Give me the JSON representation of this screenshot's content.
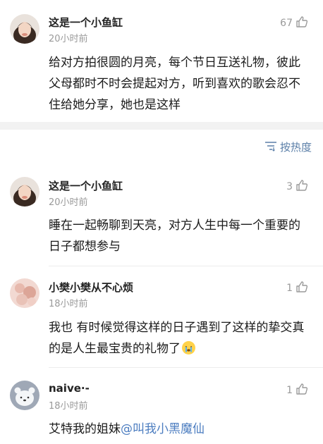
{
  "comments": [
    {
      "username": "这是一个小鱼缸",
      "time": "20小时前",
      "likes": "67",
      "body": "给对方拍很圆的月亮，每个节日互送礼物，彼此父母都时不时会提起对方，听到喜欢的歌会忍不住给她分享，她也是这样"
    },
    {
      "username": "这是一个小鱼缸",
      "time": "20小时前",
      "likes": "3",
      "body": "睡在一起畅聊到天亮，对方人生中每一个重要的日子都想参与"
    },
    {
      "username": "小樊小樊从不心烦",
      "time": "18小时前",
      "likes": "1",
      "body": "我也  有时候觉得这样的日子遇到了这样的挚交真的是人生最宝贵的礼物了"
    },
    {
      "username": "naive·-",
      "time": "18小时前",
      "likes": "1",
      "body_prefix": "艾特我的姐妹",
      "mention": "@叫我小黑魔仙"
    }
  ],
  "sort": {
    "label": "按热度",
    "icon": "sort-icon"
  },
  "icons": {
    "like": "thumbs-up-icon",
    "emoji": "crying-face-emoji"
  },
  "colors": {
    "link": "#4c7dc0",
    "muted": "#9a9a9a",
    "separator": "#f2f2f2"
  }
}
